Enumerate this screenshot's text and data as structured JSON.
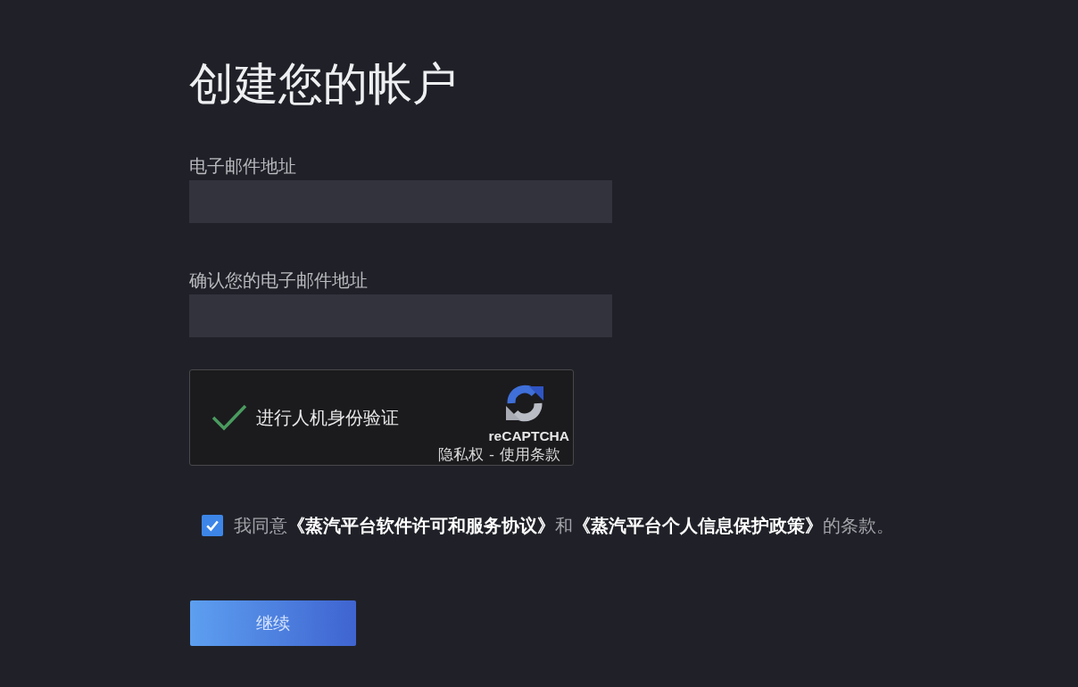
{
  "page": {
    "title": "创建您的帐户"
  },
  "fields": [
    {
      "label": "电子邮件地址"
    },
    {
      "label": "确认您的电子邮件地址"
    }
  ],
  "captcha": {
    "verified": true,
    "prompt": "进行人机身份验证",
    "brand": "reCAPTCHA",
    "links": [
      "隐私权",
      "使用条款"
    ],
    "separator": "-"
  },
  "agreement": {
    "checked": true,
    "parts": [
      {
        "kind": "text",
        "text": "我同意"
      },
      {
        "kind": "link",
        "text": "《蒸汽平台软件许可和服务协议》"
      },
      {
        "kind": "text",
        "text": "和"
      },
      {
        "kind": "link",
        "text": "《蒸汽平台个人信息保护政策》"
      },
      {
        "kind": "text",
        "text": "的条款。"
      }
    ]
  },
  "submit_button": {
    "label": "继续"
  }
}
